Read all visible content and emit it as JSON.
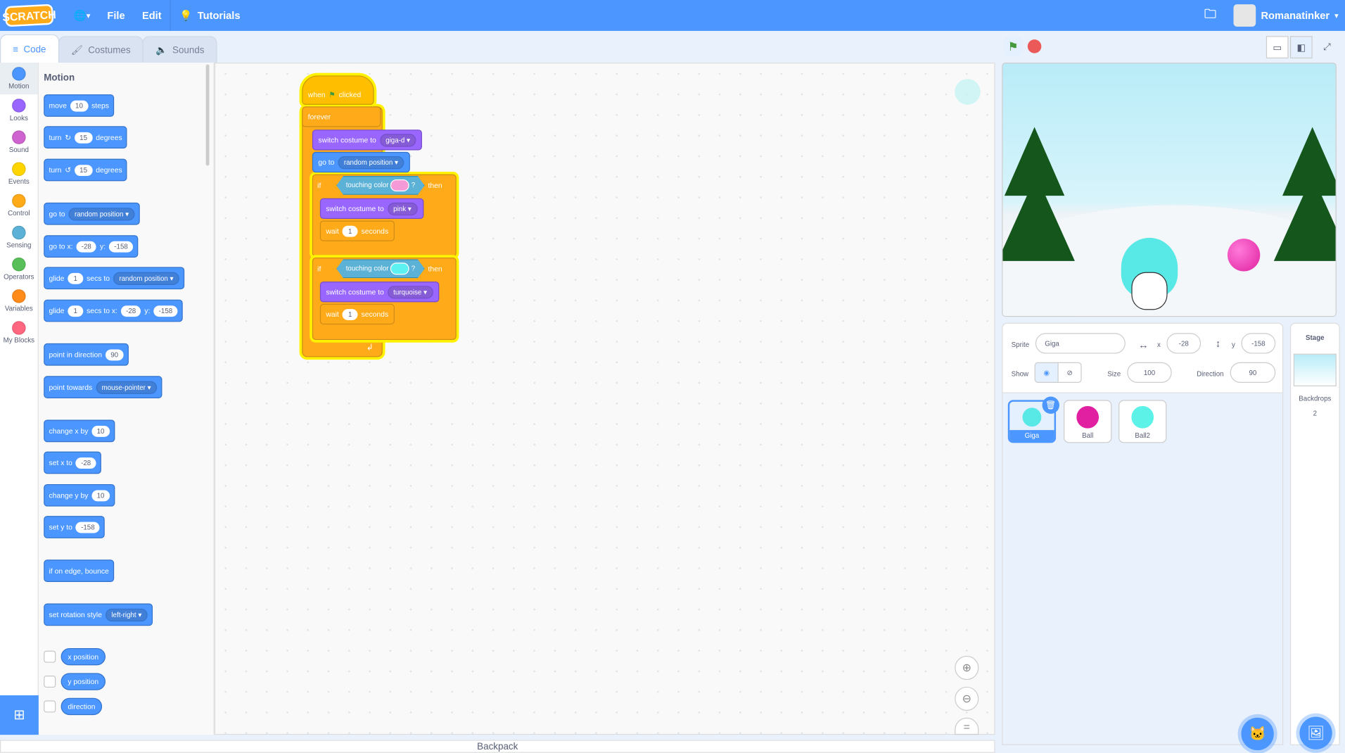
{
  "menu": {
    "logo": "SCRATCH",
    "file": "File",
    "edit": "Edit",
    "tutorials": "Tutorials",
    "username": "Romanatinker"
  },
  "tabs": [
    "Code",
    "Costumes",
    "Sounds"
  ],
  "categories": [
    {
      "label": "Motion",
      "color": "#4c97ff"
    },
    {
      "label": "Looks",
      "color": "#9966ff"
    },
    {
      "label": "Sound",
      "color": "#cf63cf"
    },
    {
      "label": "Events",
      "color": "#ffd500"
    },
    {
      "label": "Control",
      "color": "#ffab19"
    },
    {
      "label": "Sensing",
      "color": "#5cb1d6"
    },
    {
      "label": "Operators",
      "color": "#59c059"
    },
    {
      "label": "Variables",
      "color": "#ff8c1a"
    },
    {
      "label": "My Blocks",
      "color": "#ff6680"
    }
  ],
  "palette": {
    "title": "Motion",
    "move": {
      "a": "move",
      "v": "10",
      "b": "steps"
    },
    "turn_cw": {
      "a": "turn",
      "v": "15",
      "b": "degrees"
    },
    "turn_ccw": {
      "a": "turn",
      "v": "15",
      "b": "degrees"
    },
    "goto": {
      "a": "go to",
      "d": "random position"
    },
    "gotoxy": {
      "a": "go to x:",
      "x": "-28",
      "b": "y:",
      "y": "-158"
    },
    "glide_to": {
      "a": "glide",
      "v": "1",
      "b": "secs to",
      "d": "random position"
    },
    "glide_xy": {
      "a": "glide",
      "v": "1",
      "b": "secs to x:",
      "x": "-28",
      "c": "y:",
      "y": "-158"
    },
    "point_dir": {
      "a": "point in direction",
      "v": "90"
    },
    "point_tow": {
      "a": "point towards",
      "d": "mouse-pointer"
    },
    "change_x": {
      "a": "change x by",
      "v": "10"
    },
    "set_x": {
      "a": "set x to",
      "v": "-28"
    },
    "change_y": {
      "a": "change y by",
      "v": "10"
    },
    "set_y": {
      "a": "set y to",
      "v": "-158"
    },
    "bounce": "if on edge, bounce",
    "rot": {
      "a": "set rotation style",
      "d": "left-right"
    },
    "rep_x": "x position",
    "rep_y": "y position",
    "rep_dir": "direction"
  },
  "script": {
    "hat_a": "when",
    "hat_b": "clicked",
    "forever": "forever",
    "costume1": {
      "a": "switch costume to",
      "d": "giga-d"
    },
    "goto": {
      "a": "go to",
      "d": "random position"
    },
    "if1": {
      "if": "if",
      "cond": "touching color",
      "q": "?",
      "then": "then",
      "color": "#f49ad6"
    },
    "costume2": {
      "a": "switch costume to",
      "d": "pink"
    },
    "wait1": {
      "a": "wait",
      "v": "1",
      "b": "seconds"
    },
    "if2": {
      "if": "if",
      "cond": "touching color",
      "q": "?",
      "then": "then",
      "color": "#5cf2f2"
    },
    "costume3": {
      "a": "switch costume to",
      "d": "turquoise"
    },
    "wait2": {
      "a": "wait",
      "v": "1",
      "b": "seconds"
    }
  },
  "backpack": "Backpack",
  "sprite_info": {
    "sprite_label": "Sprite",
    "name": "Giga",
    "x_label": "x",
    "x": "-28",
    "y_label": "y",
    "y": "-158",
    "show_label": "Show",
    "size_label": "Size",
    "size": "100",
    "dir_label": "Direction",
    "direction": "90"
  },
  "sprites": [
    {
      "name": "Giga"
    },
    {
      "name": "Ball",
      "color": "#e020a0"
    },
    {
      "name": "Ball2",
      "color": "#5cf2e8"
    }
  ],
  "stage_pane": {
    "title": "Stage",
    "backdrops_label": "Backdrops",
    "backdrops": "2"
  }
}
